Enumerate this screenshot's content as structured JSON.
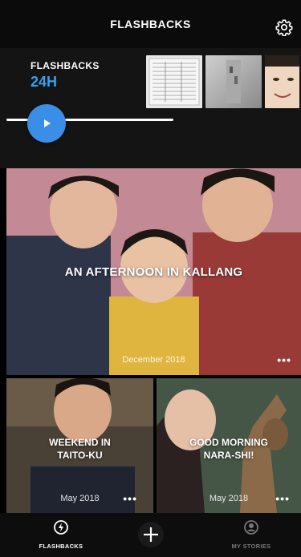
{
  "header": {
    "title": "FLASHBACKS",
    "settings_icon": "gear-icon"
  },
  "strip": {
    "label": "FLASHBACKS",
    "period": "24H"
  },
  "hero": {
    "title": "AN AFTERNOON IN KALLANG",
    "date": "December 2018",
    "more": "•••"
  },
  "cards": [
    {
      "title_line1": "WEEKEND IN",
      "title_line2": "TAITO-KU",
      "date": "May 2018",
      "more": "•••"
    },
    {
      "title_line1": "GOOD MORNING",
      "title_line2": "NARA-SHI!",
      "date": "May 2018",
      "more": "•••"
    }
  ],
  "nav": {
    "left_label": "FLASHBACKS",
    "right_label": "MY STORIES",
    "center_icon": "plus-icon"
  },
  "colors": {
    "accent": "#3a8ee5",
    "label_blue": "#3aa0e8"
  }
}
